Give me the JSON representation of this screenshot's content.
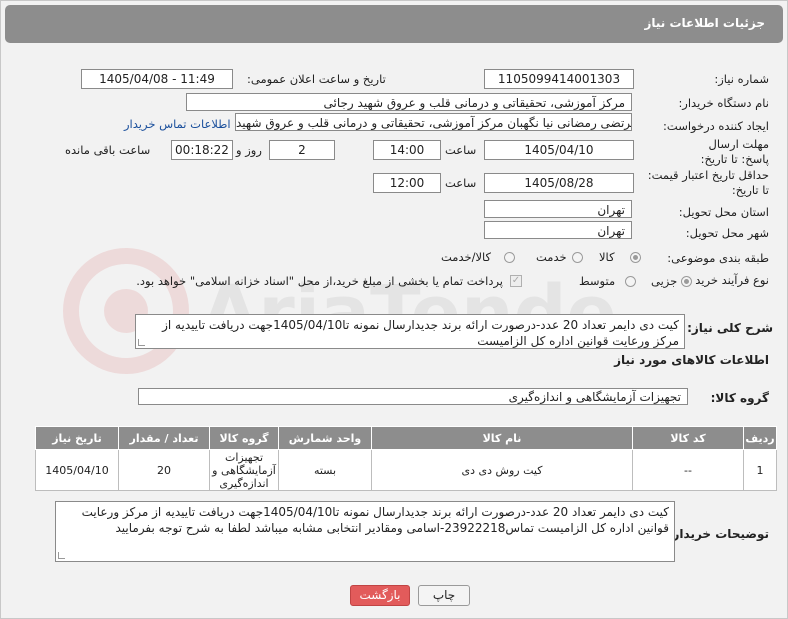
{
  "header": {
    "title": "جزئیات اطلاعات نیاز"
  },
  "form": {
    "need_number_label": "شماره نیاز:",
    "need_number": "1105099414001303",
    "announce_label": "تاریخ و ساعت اعلان عمومی:",
    "announce_value": "1405/04/08 - 11:49",
    "buyer_label": "نام دستگاه خریدار:",
    "buyer_value": "مرکز آموزشی، تحقیقاتی و درمانی قلب و عروق شهید رجائی",
    "creator_label": "ایجاد کننده درخواست:",
    "creator_value": "مرتضی رمضانی نیا نگهبان مرکز آموزشی، تحقیقاتی و درمانی قلب و عروق شهید",
    "contact_link": "اطلاعات تماس خریدار",
    "deadline_label": "مهلت ارسال پاسخ: تا تاریخ:",
    "deadline_date": "1405/04/10",
    "time_label": "ساعت",
    "deadline_time": "14:00",
    "days_value": "2",
    "days_label": "روز و",
    "remaining_value": "00:18:22",
    "remaining_label": "ساعت باقی مانده",
    "validity_label": "حداقل تاریخ اعتبار قیمت: تا تاریخ:",
    "validity_date": "1405/08/28",
    "validity_time": "12:00",
    "province_label": "استان محل تحویل:",
    "province_value": "تهران",
    "city_label": "شهر محل تحویل:",
    "city_value": "تهران",
    "category_label": "طبقه بندی موضوعی:",
    "category_options": [
      "کالا",
      "خدمت",
      "کالا/خدمت"
    ],
    "category_selected": "کالا",
    "process_label": "نوع فرآیند خرید :",
    "process_options": [
      "جزیی",
      "متوسط"
    ],
    "process_selected": "جزیی",
    "payment_note": "پرداخت تمام یا بخشی از مبلغ خرید،از محل \"اسناد خزانه اسلامی\" خواهد بود."
  },
  "description": {
    "label": "شرح کلی نیاز:",
    "text": "کیت دی دایمر تعداد 20 عدد-درصورت ارائه برند جدیدارسال نمونه تا1405/04/10جهت دریافت تاییدیه از مرکز ورعایت قوانین اداره کل الزامیست"
  },
  "goods_section": {
    "title": "اطلاعات کالاهای مورد نیاز"
  },
  "goods_group": {
    "label": "گروه کالا:",
    "value": "تجهیزات آزمایشگاهی و اندازه‌گیری"
  },
  "table": {
    "headers": [
      "ردیف",
      "کد کالا",
      "نام کالا",
      "واحد شمارش",
      "گروه کالا",
      "تعداد / مقدار",
      "تاریخ نیاز"
    ],
    "rows": [
      {
        "row": "1",
        "code": "--",
        "name": "کیت روش دی دی",
        "unit": "بسته",
        "group": "تجهیزات آزمایشگاهی و اندازه‌گیری",
        "qty": "20",
        "date": "1405/04/10"
      }
    ]
  },
  "buyer_notes": {
    "label": "توضیحات خریدار:",
    "text": "کیت دی دایمر تعداد 20 عدد-درصورت ارائه برند جدیدارسال نمونه تا1405/04/10جهت دریافت تاییدیه از مرکز ورعایت قوانین اداره کل الزامیست تماس23922218-اسامی ومقادیر انتخابی مشابه میباشد لطفا به شرح توجه بفرمایید"
  },
  "buttons": {
    "print": "چاپ",
    "back": "بازگشت"
  },
  "watermark": {
    "text": "AriaTender.net"
  }
}
